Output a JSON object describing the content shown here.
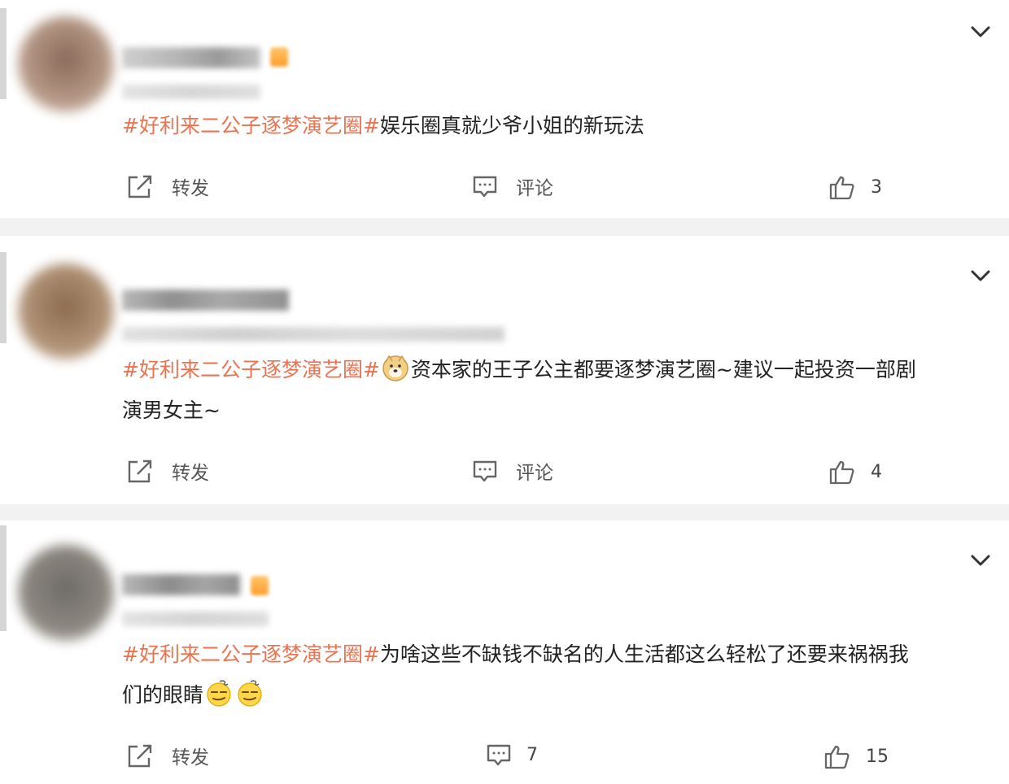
{
  "comments": [
    {
      "hashtag": "#好利来二公子逐梦演艺圈#",
      "line1": "娱乐圈真就少爷小姐的新玩法",
      "line2": "",
      "actions": {
        "forward": "转发",
        "comment": "评论",
        "likes": "3"
      }
    },
    {
      "hashtag": "#好利来二公子逐梦演艺圈#",
      "line1": "资本家的王子公主都要逐梦演艺圈~建议一起投资一部剧",
      "line2": "演男女主~",
      "actions": {
        "forward": "转发",
        "comment": "评论",
        "likes": "4"
      }
    },
    {
      "hashtag": "#好利来二公子逐梦演艺圈#",
      "line1": "为啥这些不缺钱不缺名的人生活都这么轻松了还要来祸祸我",
      "line2": "们的眼睛",
      "actions": {
        "forward": "转发",
        "comment": "7",
        "likes": "15"
      }
    }
  ],
  "colors": {
    "hashtag": "#eb7350",
    "text": "#222222",
    "separator": "#f2f2f2"
  },
  "icons": [
    "chevron-down-icon",
    "forward-icon",
    "comment-icon",
    "thumbs-up-icon",
    "doge-emoji",
    "dizzy-face-emoji"
  ]
}
